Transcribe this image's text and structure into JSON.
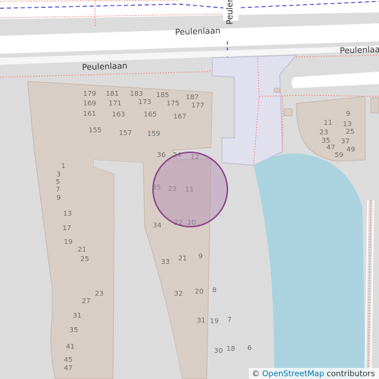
{
  "map": {
    "streets": {
      "peulenlaan_main": "Peulenlaan",
      "peulenlaan_service": "Peulenlaan",
      "peulenlaan_right": "Peulenlaan",
      "peulenlaan_vertical": "Peulenl"
    },
    "colors": {
      "background": "#dcdcdc",
      "road": "#ffffff",
      "building": "#d9cec5",
      "water": "#aad3df",
      "marker_fill": "#b58fb4",
      "marker_stroke": "#8a3f8a",
      "footway": "#fa8072",
      "boundary": "#3030c8"
    },
    "house_numbers": [
      "179",
      "181",
      "183",
      "185",
      "187",
      "169",
      "171",
      "173",
      "175",
      "177",
      "161",
      "163",
      "165",
      "167",
      "155",
      "157",
      "159",
      "1",
      "3",
      "5",
      "7",
      "9",
      "13",
      "17",
      "19",
      "21",
      "25",
      "23",
      "27",
      "31",
      "35",
      "41",
      "45",
      "47",
      "36",
      "24",
      "12",
      "35",
      "23",
      "11",
      "34",
      "22",
      "10",
      "33",
      "21",
      "9",
      "32",
      "20",
      "8",
      "31",
      "19",
      "7",
      "30",
      "18",
      "6",
      "9",
      "11",
      "13",
      "23",
      "25",
      "35",
      "37",
      "47",
      "49",
      "59"
    ],
    "location_marker": {
      "label": "location-marker"
    }
  },
  "attribution": {
    "copyright": "©",
    "link_text": "OpenStreetMap",
    "suffix": " contributors"
  }
}
